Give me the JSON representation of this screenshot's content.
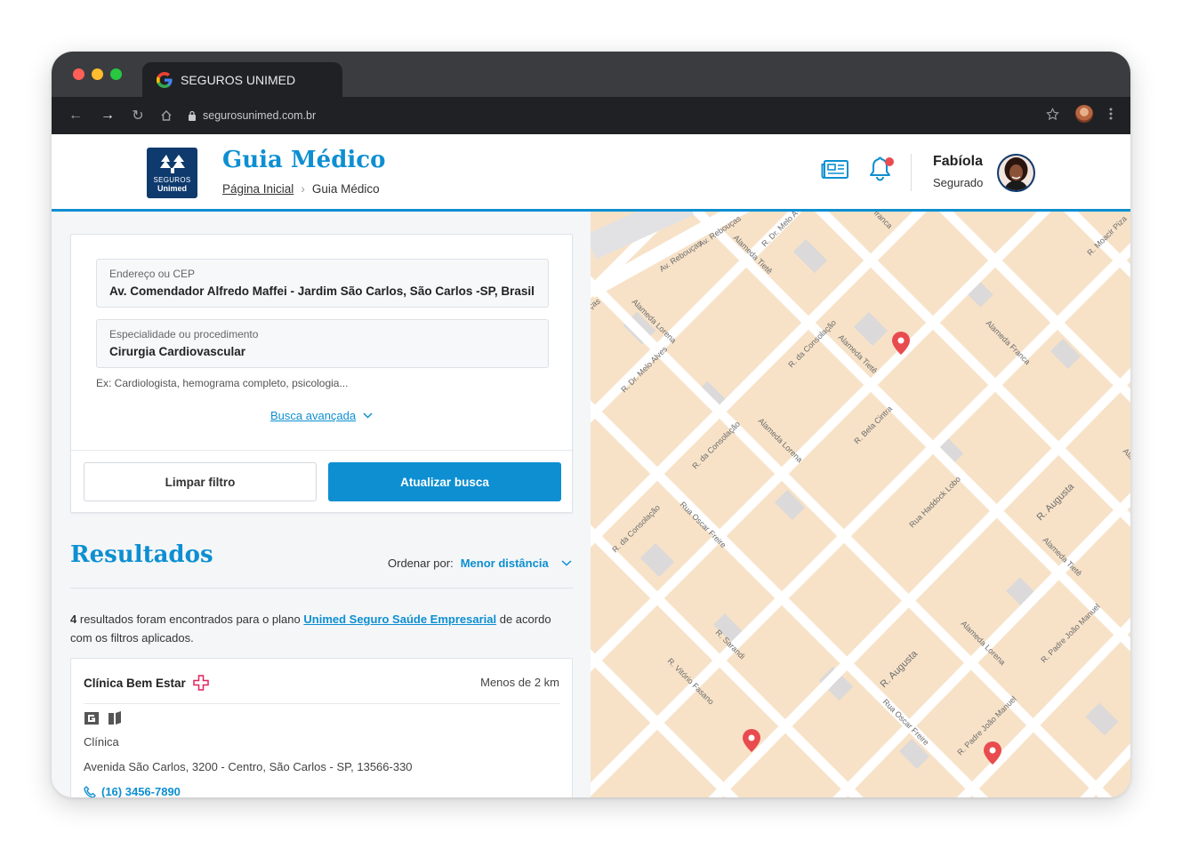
{
  "browser": {
    "tab_title": "SEGUROS UNIMED",
    "url": "segurosunimed.com.br",
    "traffic_lights": [
      "#ff5f57",
      "#febc2e",
      "#28c840"
    ]
  },
  "header": {
    "logo_line1": "SEGUROS",
    "logo_line2": "Unimed",
    "title": "Guia Médico",
    "breadcrumb_home": "Página Inicial",
    "breadcrumb_current": "Guia Médico",
    "user_name": "Fabíola",
    "user_role": "Segurado",
    "news_icon": "newspaper-icon",
    "bell_icon": "bell-icon"
  },
  "search": {
    "address_label": "Endereço ou CEP",
    "address_value": "Av. Comendador Alfredo Maffei - Jardim São Carlos, São Carlos -SP, Brasil",
    "specialty_label": "Especialidade ou procedimento",
    "specialty_value": "Cirurgia Cardiovascular",
    "hint": "Ex: Cardiologista, hemograma completo, psicologia...",
    "advanced": "Busca avançada",
    "clear_button": "Limpar filtro",
    "update_button": "Atualizar busca"
  },
  "results": {
    "title": "Resultados",
    "order_label": "Ordenar por:",
    "order_value": "Menor distância",
    "count": "4",
    "text_before": "resultados foram encontrados para o plano",
    "plan": "Unimed Seguro Saúde Empresarial",
    "text_after": "de acordo com os filtros aplicados.",
    "items": [
      {
        "name": "Clínica Bem Estar",
        "distance": "Menos de 2 km",
        "type": "Clínica",
        "address": "Avenida São Carlos, 3200 - Centro, São Carlos - SP, 13566-330",
        "phone": "(16) 3456-7890"
      }
    ]
  },
  "map": {
    "streets": [
      "Av. Rebouças",
      "Av. Rebouças",
      "Alameda Tietê",
      "R. Dr. Melo A",
      "Alameda Franca",
      "R. Moacir Piza",
      "Alameda Lorena",
      "R. Dr. Melo Alves",
      "R. da Consolação",
      "Alameda Tietê",
      "R. Bela Cintra",
      "Alameda Lorena",
      "R. da Consolação",
      "Rua Haddock Lobo",
      "R. Augusta",
      "R. da Consolação",
      "Rua Oscar Freire",
      "Alameda Tietê",
      "R. Padre João Manuel",
      "R. Sarandi",
      "R. Vitório Fasano",
      "Alameda Lorena",
      "R. Augusta",
      "Rua Oscar Freire",
      "R. Padre João Manuel",
      "ças",
      "franca",
      "Ala"
    ],
    "pin_color": "#e84c4f"
  },
  "colors": {
    "brand_blue": "#0d8fd1",
    "brand_navy": "#0e3a6e"
  }
}
